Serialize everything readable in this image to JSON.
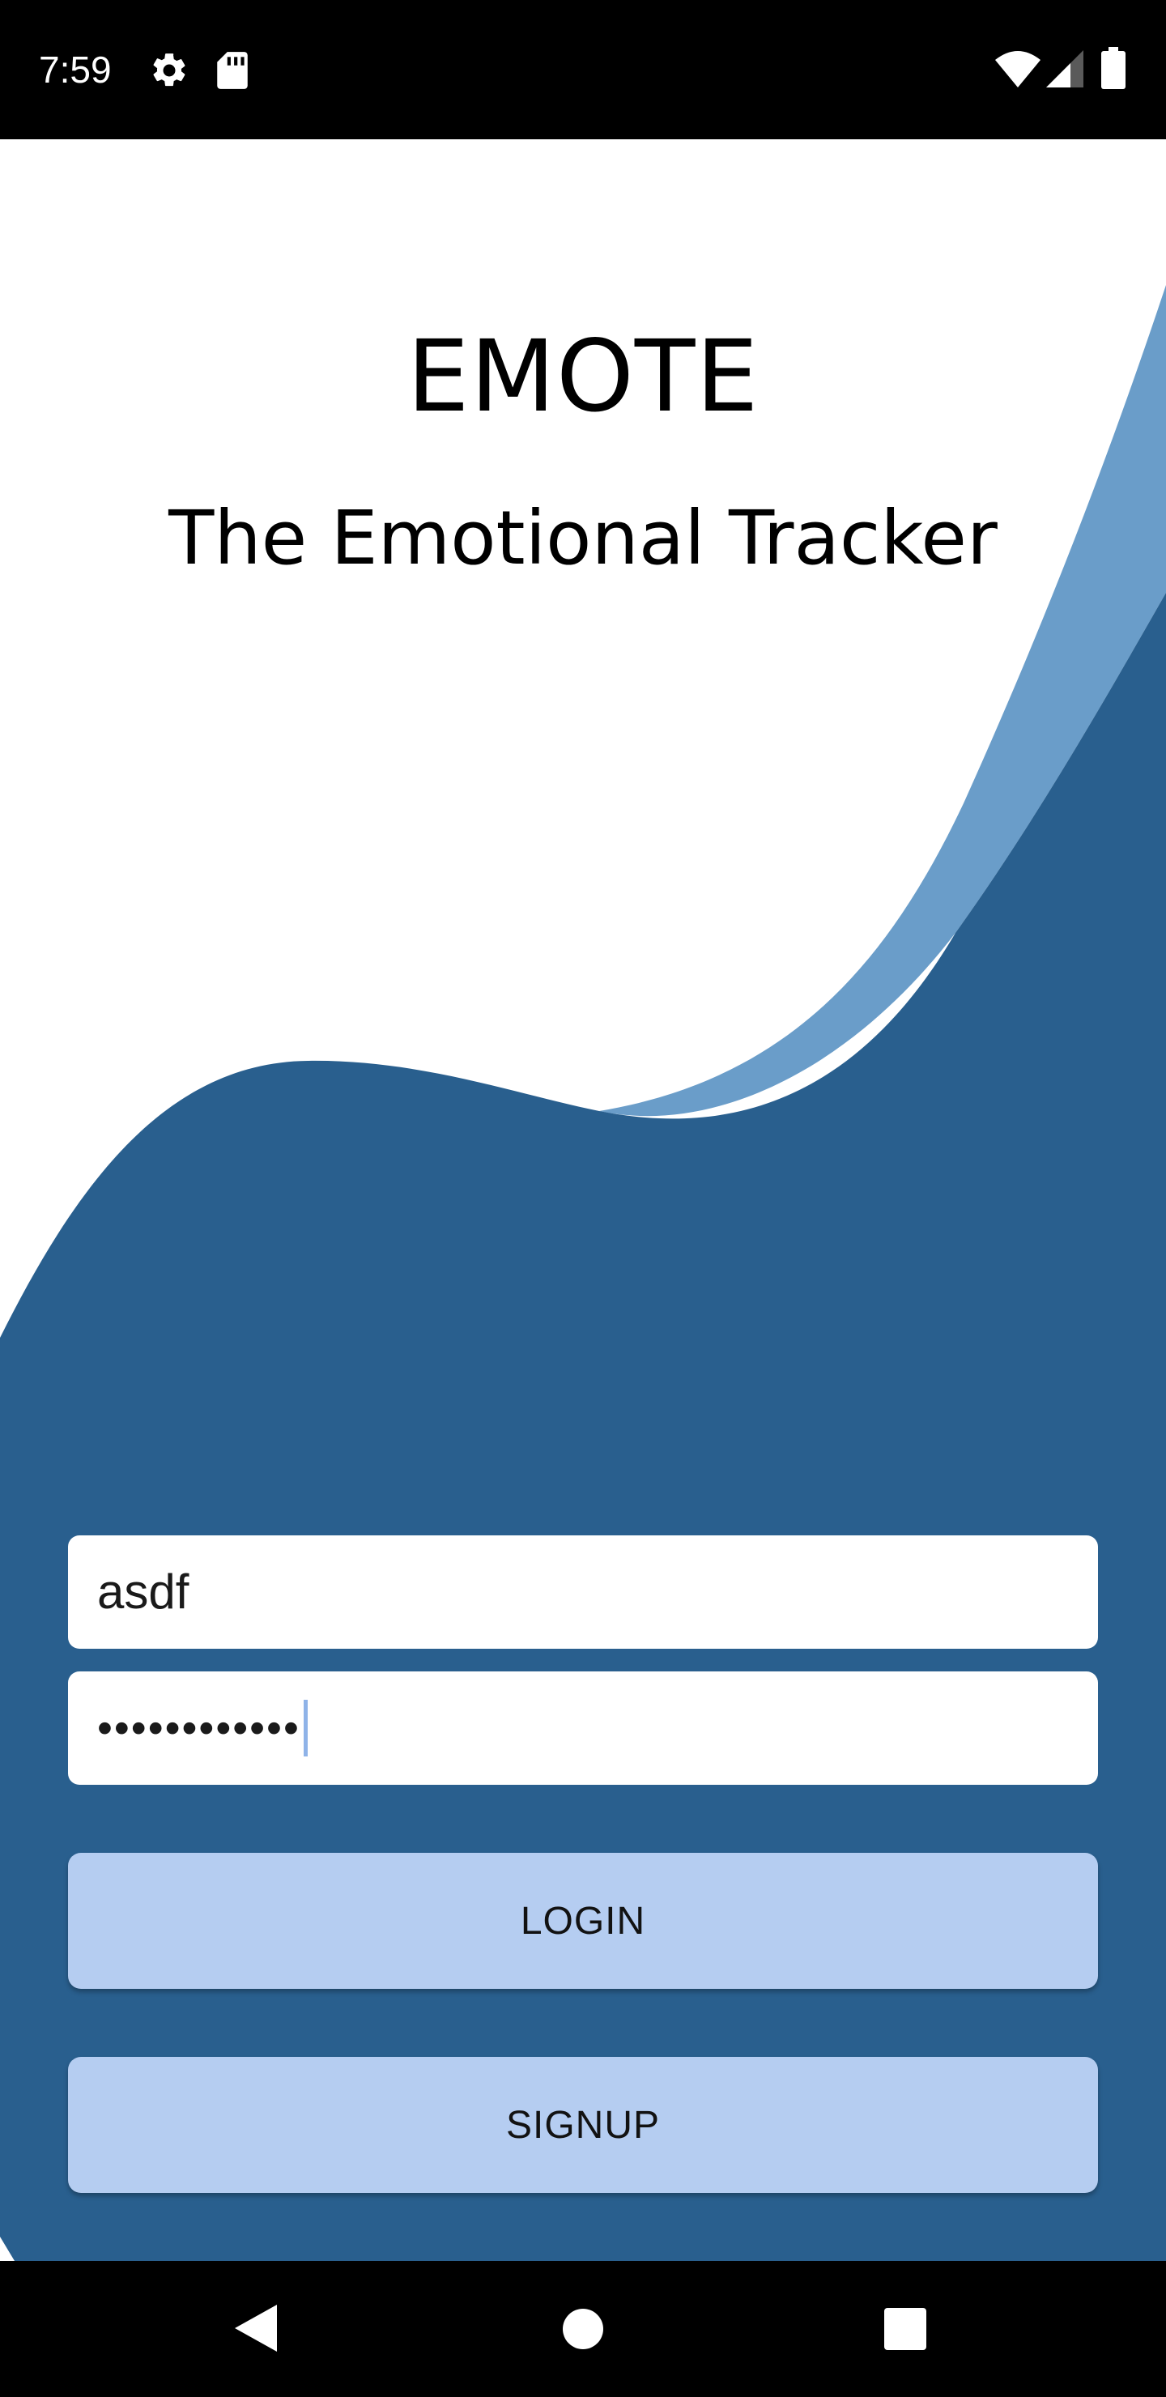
{
  "status_bar": {
    "time": "7:59",
    "icons": [
      "settings-gear-icon",
      "sd-card-icon",
      "wifi-icon",
      "cellular-signal-icon",
      "battery-icon"
    ]
  },
  "header": {
    "title": "EMOTE",
    "subtitle": "The Emotional Tracker"
  },
  "login_form": {
    "username_value": "asdf",
    "password_value": "••••••••••••"
  },
  "buttons": {
    "login_label": "LOGIN",
    "signup_label": "SIGNUP"
  },
  "nav_bar": {
    "icons": [
      "back-icon",
      "home-icon",
      "recents-icon"
    ]
  },
  "colors": {
    "wave_light": "#6a9dc9",
    "wave_dark": "#295f8e",
    "button_bg": "#b5cdf1",
    "field_bg": "#ffffff",
    "caret": "#8fb3e8"
  }
}
